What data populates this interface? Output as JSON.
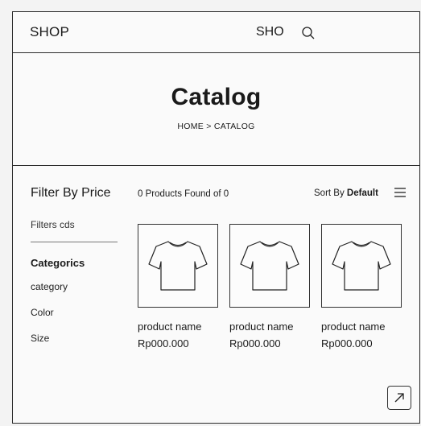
{
  "header": {
    "brand": "SHOP",
    "nav_text": "SHO",
    "icons": [
      "search-icon"
    ]
  },
  "hero": {
    "title": "Catalog",
    "breadcrumb": "HOME > CATALOG"
  },
  "sidebar": {
    "title": "Filter By Price",
    "filters_text": "Filters cds",
    "categories_title": "Categorics",
    "items": [
      "category",
      "Color",
      "Size"
    ]
  },
  "toolbar": {
    "found_text": "0 Products Found of 0",
    "sort_label": "Sort By",
    "sort_value": "Default"
  },
  "products": [
    {
      "name": "product name",
      "price": "Rp000.000"
    },
    {
      "name": "product name",
      "price": "Rp000.000"
    },
    {
      "name": "product name",
      "price": "Rp000.000"
    }
  ],
  "fab": {
    "icon": "arrow-up-right-icon"
  }
}
